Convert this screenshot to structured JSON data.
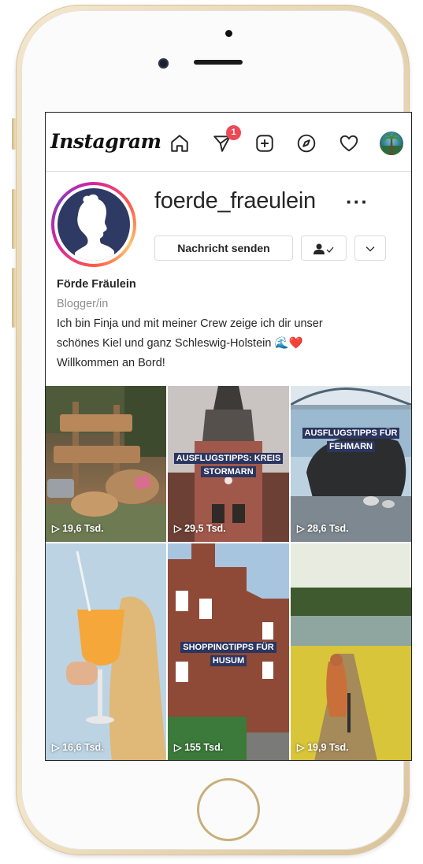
{
  "app": {
    "logo_text": "Instagram",
    "dm_badge_count": "1",
    "nav_icons": [
      "home-icon",
      "direct-message-icon",
      "new-post-icon",
      "explore-icon",
      "activity-heart-icon",
      "profile-avatar-icon"
    ]
  },
  "profile": {
    "username": "foerde_fraeulein",
    "more_label": "···",
    "message_button": "Nachricht senden",
    "follow_status_icon": "person-check-icon",
    "suggestions_icon": "chevron-down-icon",
    "display_name": "Förde Fräulein",
    "category": "Blogger/in",
    "bio_line1": "Ich bin Finja und mit meiner Crew zeige ich dir unser",
    "bio_line2": "schönes Kiel und ganz Schleswig-Holstein 🌊❤️",
    "bio_line3": "Willkommen an Bord!"
  },
  "posts": [
    {
      "views": "▷ 19,6 Tsd.",
      "caption": ""
    },
    {
      "views": "▷ 29,5 Tsd.",
      "caption": "AUSFLUGSTIPPS: KREIS STORMARN"
    },
    {
      "views": "▷ 28,6 Tsd.",
      "caption": "AUSFLUGSTIPPS FÜR FEHMARN"
    },
    {
      "views": "▷ 16,6 Tsd.",
      "caption": ""
    },
    {
      "views": "▷ 155 Tsd.",
      "caption": "SHOPPINGTIPPS FÜR HUSUM"
    },
    {
      "views": "▷ 19,9 Tsd.",
      "caption": ""
    }
  ],
  "colors": {
    "badge": "#ed4956",
    "caption_bg": "#2b3560",
    "profile_bg": "#2e3a63",
    "ring": [
      "#d6249f",
      "#fd5949",
      "#fdc468",
      "#8a3ab9"
    ]
  }
}
